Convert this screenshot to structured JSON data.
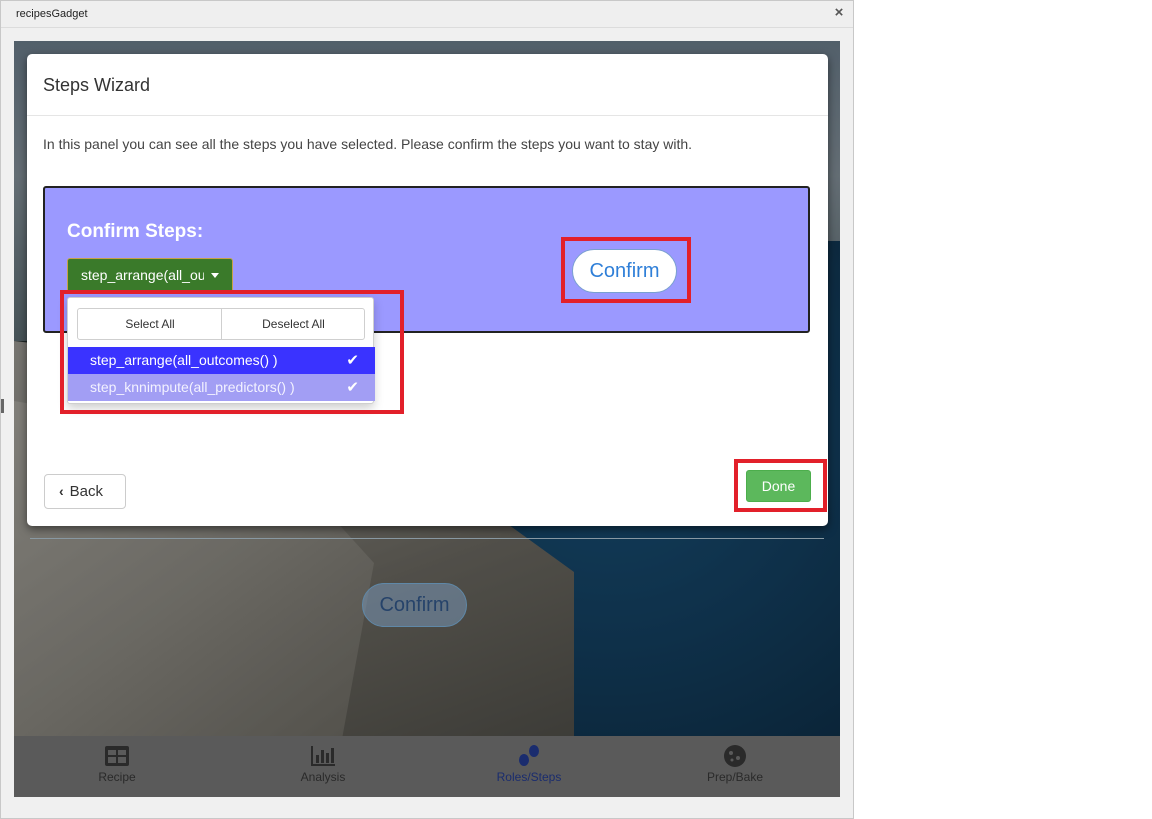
{
  "window": {
    "title": "recipesGadget",
    "close_label": "×"
  },
  "background": {
    "confirm_label": "Confirm"
  },
  "nav": {
    "items": [
      {
        "label": "Recipe",
        "icon": "table-icon"
      },
      {
        "label": "Analysis",
        "icon": "bar-chart-icon"
      },
      {
        "label": "Roles/Steps",
        "icon": "footprints-icon"
      },
      {
        "label": "Prep/Bake",
        "icon": "cookie-icon"
      }
    ],
    "active": "Roles/Steps"
  },
  "modal": {
    "title": "Steps Wizard",
    "intro": "In this panel you can see all the steps you have selected. Please confirm the steps you want to stay with.",
    "panel_heading": "Confirm Steps:",
    "dropdown_selected": "step_arrange(all_outcomes() )",
    "confirm_label": "Confirm",
    "menu": {
      "select_all": "Select All",
      "deselect_all": "Deselect All",
      "options": [
        {
          "label": "step_arrange(all_outcomes() )",
          "checked": true
        },
        {
          "label": "step_knnimpute(all_predictors() )",
          "checked": true
        }
      ],
      "check_glyph": "✔"
    },
    "back_label": "Back",
    "done_label": "Done"
  },
  "colors": {
    "panel_bg": "#9b99ff",
    "dropdown_green": "#3a7a2a",
    "done_green": "#5cb85c",
    "highlight_red": "#e2202a",
    "option_selected": "#3a33ff",
    "option_second": "#a29ef4"
  }
}
